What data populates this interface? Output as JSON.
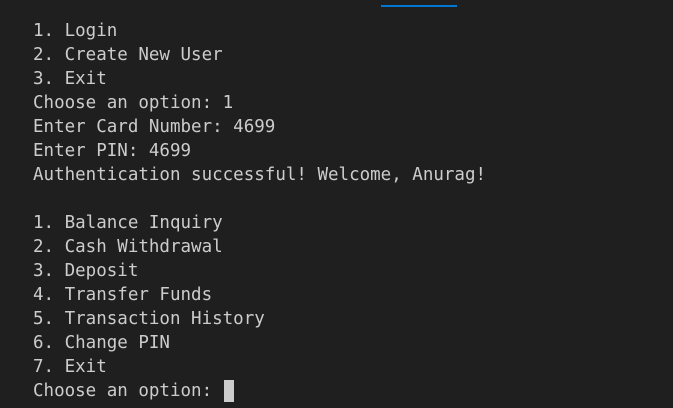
{
  "colors": {
    "background": "#1f1f1f",
    "text": "#cccccc",
    "accent": "#0078d4"
  },
  "terminal": {
    "lines": [
      "1. Login",
      "2. Create New User",
      "3. Exit",
      "Choose an option: 1",
      "Enter Card Number: 4699",
      "Enter PIN: 4699",
      "Authentication successful! Welcome, Anurag!",
      "",
      "1. Balance Inquiry",
      "2. Cash Withdrawal",
      "3. Deposit",
      "4. Transfer Funds",
      "5. Transaction History",
      "6. Change PIN",
      "7. Exit"
    ],
    "prompt": "Choose an option: "
  }
}
